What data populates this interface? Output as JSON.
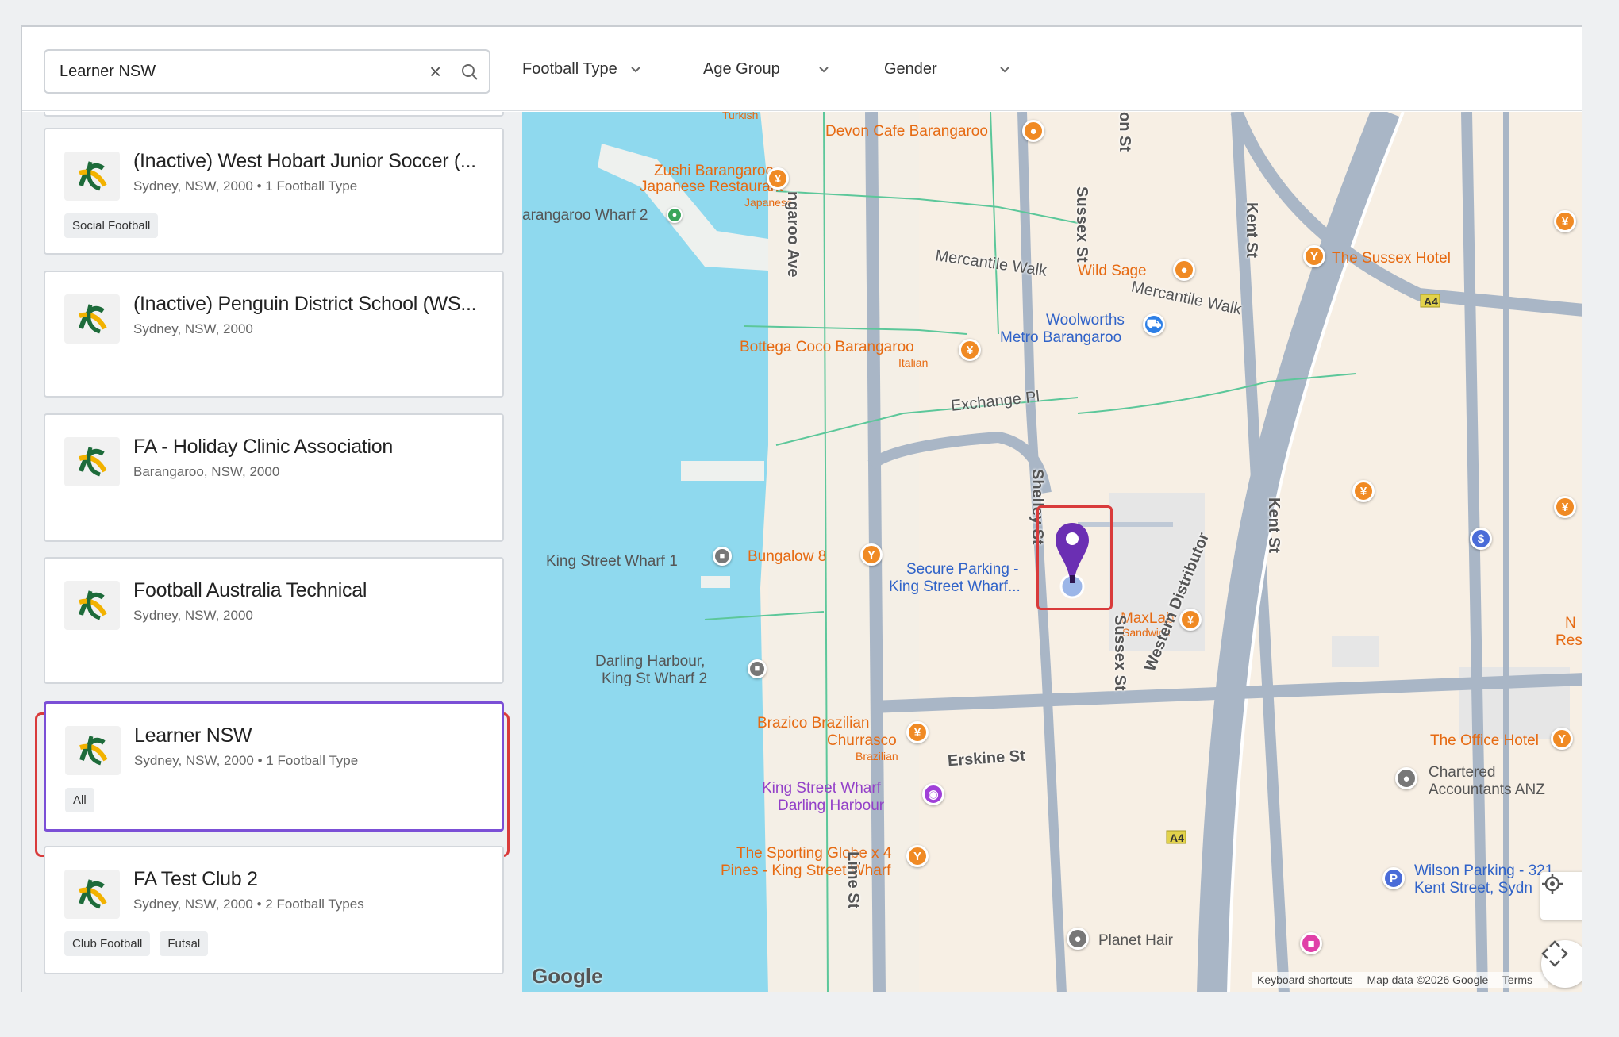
{
  "search": {
    "value": "Learner NSW",
    "clear_icon": "close-icon",
    "search_icon": "search-icon"
  },
  "filters": [
    {
      "label": "Football Type"
    },
    {
      "label": "Age Group"
    },
    {
      "label": "Gender"
    }
  ],
  "clubs": [
    {
      "name": "(Inactive) West Hobart Junior Soccer (...",
      "location": "Sydney, NSW, 2000 • 1 Football Type",
      "tags": [
        "Social Football"
      ]
    },
    {
      "name": "(Inactive) Penguin District School (WS...",
      "location": "Sydney, NSW, 2000",
      "tags": []
    },
    {
      "name": "FA - Holiday Clinic Association",
      "location": "Barangaroo, NSW, 2000",
      "tags": []
    },
    {
      "name": "Football Australia Technical",
      "location": "Sydney, NSW, 2000",
      "tags": []
    },
    {
      "name": "Learner NSW",
      "location": "Sydney, NSW, 2000 • 1 Football Type",
      "tags": [
        "All"
      ],
      "selected": true
    },
    {
      "name": "FA Test Club 2",
      "location": "Sydney, NSW, 2000 • 2 Football Types",
      "tags": [
        "Club Football",
        "Futsal"
      ]
    }
  ],
  "map": {
    "pois": {
      "devon": "Devon Cafe Barangaroo",
      "zushi1": "Zushi Barangaroo -",
      "zushi2": "Japanese Restaurant",
      "zushi3": "Japanese",
      "wharf2": "arangaroo Wharf 2",
      "wildsage": "Wild Sage",
      "sussexhotel": "The Sussex Hotel",
      "woolworths1": "Woolworths",
      "woolworths2": "Metro Barangaroo",
      "bottega1": "Bottega Coco Barangaroo",
      "bottega2": "Italian",
      "kingwharf1": "King Street Wharf 1",
      "bungalow": "Bungalow 8",
      "secure1": "Secure Parking -",
      "secure2": "King Street Wharf...",
      "maxlab1": "MaxLab",
      "maxlab2": "Sandwich",
      "darling1": "Darling Harbour,",
      "darling2": "King St Wharf 2",
      "brazico1": "Brazico Brazilian",
      "brazico2": "Churrasco",
      "brazico3": "Brazilian",
      "officehotel": "The Office Hotel",
      "chartered1": "Chartered",
      "chartered2": "Accountants ANZ",
      "ksw1": "King Street Wharf",
      "ksw2": "Darling Harbour",
      "sporting1": "The Sporting Globe x 4",
      "sporting2": "Pines - King Street Wharf",
      "wilson1": "Wilson Parking - 321",
      "wilson2": "Kent Street, Sydn",
      "planethair": "Planet Hair",
      "turkish": "Turkish",
      "nres1": "N",
      "nres2": "Res"
    },
    "streets": {
      "mercantile1": "Mercantile Walk",
      "mercantile2": "Mercantile Walk",
      "exchange": "Exchange Pl",
      "erskine": "Erskine St",
      "sussex1": "Sussex St",
      "sussex2": "Sussex St",
      "kent1": "Kent St",
      "kent2": "Kent St",
      "barangaroo": "ngaroo Ave",
      "shelley": "Shelley St",
      "western": "Western Distributor",
      "lime": "Lime St",
      "onst": "on St",
      "a4a": "A4",
      "a4b": "A4"
    },
    "google": "Google",
    "attribution": {
      "shortcuts": "Keyboard shortcuts",
      "data": "Map data ©2026 Google",
      "terms": "Terms"
    },
    "colors": {
      "water": "#8fd9ee",
      "land": "#f7efe4",
      "road": "#a9b6c6",
      "marker": "#6b2fb3",
      "highlight": "#d93b3b"
    }
  }
}
